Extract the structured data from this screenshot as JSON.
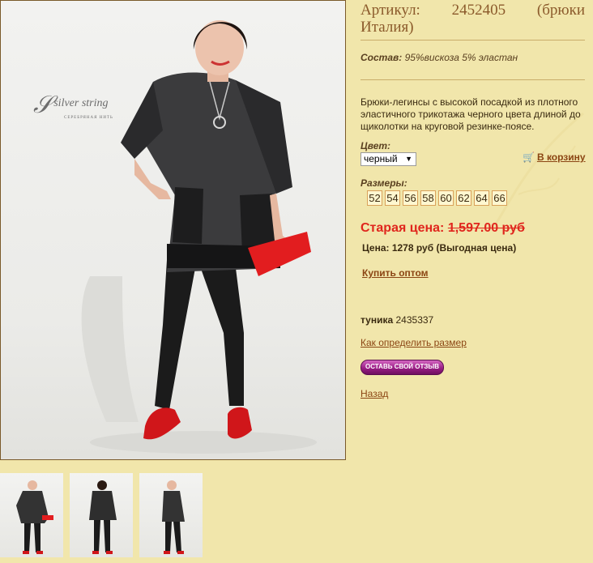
{
  "brand": {
    "main": "silver string",
    "sub": "СЕРЕБРЯНАЯ НИТЬ"
  },
  "product": {
    "article_label": "Артикул:",
    "article_number": "2452405",
    "article_note": "(брюки",
    "article_note2": "Италия)",
    "composition_label": "Состав:",
    "composition_value": "95%вискоза 5% эластан",
    "description": "Брюки-легинсы с высокой посадкой из плотного эластичного трикотажа черного цвета длиной до щиколотки на круговой резинке-поясе.",
    "color_label": "Цвет:",
    "color_value": "черный",
    "cart_label": "В корзину",
    "sizes_label": "Размеры:",
    "sizes": [
      "52",
      "54",
      "56",
      "58",
      "60",
      "62",
      "64",
      "66"
    ],
    "old_price_label": "Старая цена:",
    "old_price_value": "1,597.00 руб",
    "new_price": "Цена: 1278 руб (Выгодная цена)",
    "wholesale_link": "Купить оптом",
    "tunic_label": "туника",
    "tunic_number": "2435337",
    "size_help_link": "Как определить размер",
    "review_button": "ОСТАВЬ СВОЙ ОТЗЫВ",
    "back_link": "Назад"
  },
  "colors": {
    "background": "#f1e6ab",
    "link": "#8b4513",
    "old_price": "#e0261d",
    "title": "#8b5a2b"
  },
  "icons": {
    "cart": "cart-icon",
    "select_arrow": "chevron-down-icon"
  }
}
